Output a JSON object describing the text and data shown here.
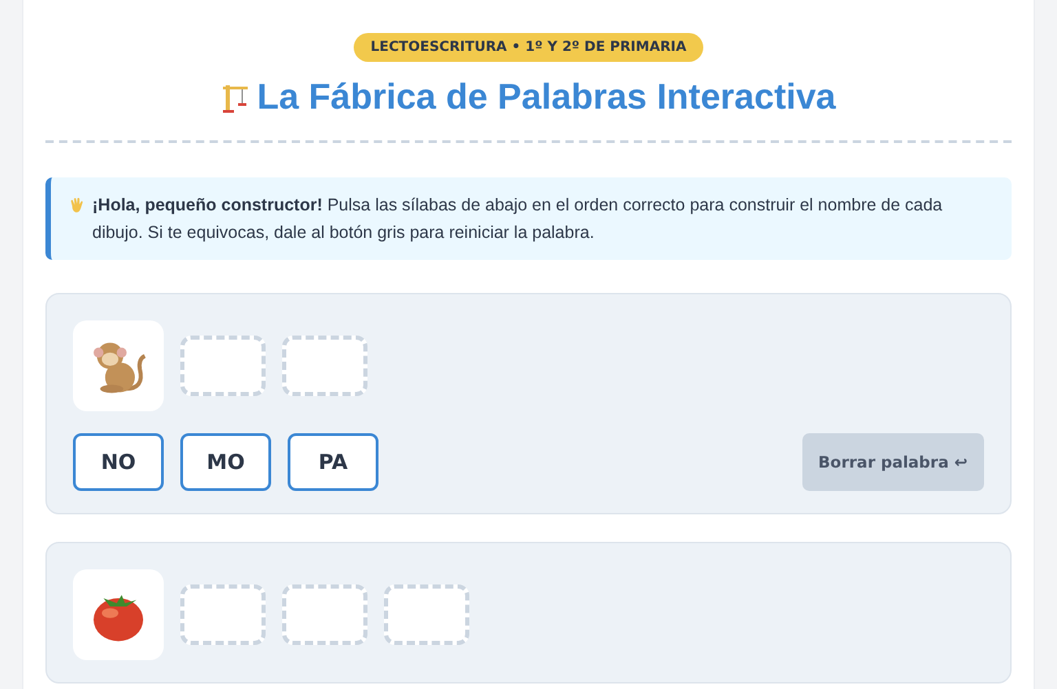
{
  "badge": "LECTOESCRITURA • 1º Y 2º DE PRIMARIA",
  "title": "La Fábrica de Palabras Interactiva",
  "intro": "**¡Hola, pequeño constructor!** Pulsa las sílabas de abajo en el orden correcto para construir el nombre de cada dibujo. Si te equivocas, dale al botón gris para reiniciar la palabra.",
  "words": [
    {
      "kind": "monkey",
      "slots": [
        {
          "filled": false
        },
        {
          "filled": false
        }
      ],
      "syllables": [
        "NO",
        "MO",
        "PA"
      ],
      "reset": "Borrar palabra ↩"
    },
    {
      "kind": "tomato",
      "slots": [
        {
          "filled": false
        },
        {
          "filled": false
        },
        {
          "filled": false
        }
      ]
    }
  ]
}
